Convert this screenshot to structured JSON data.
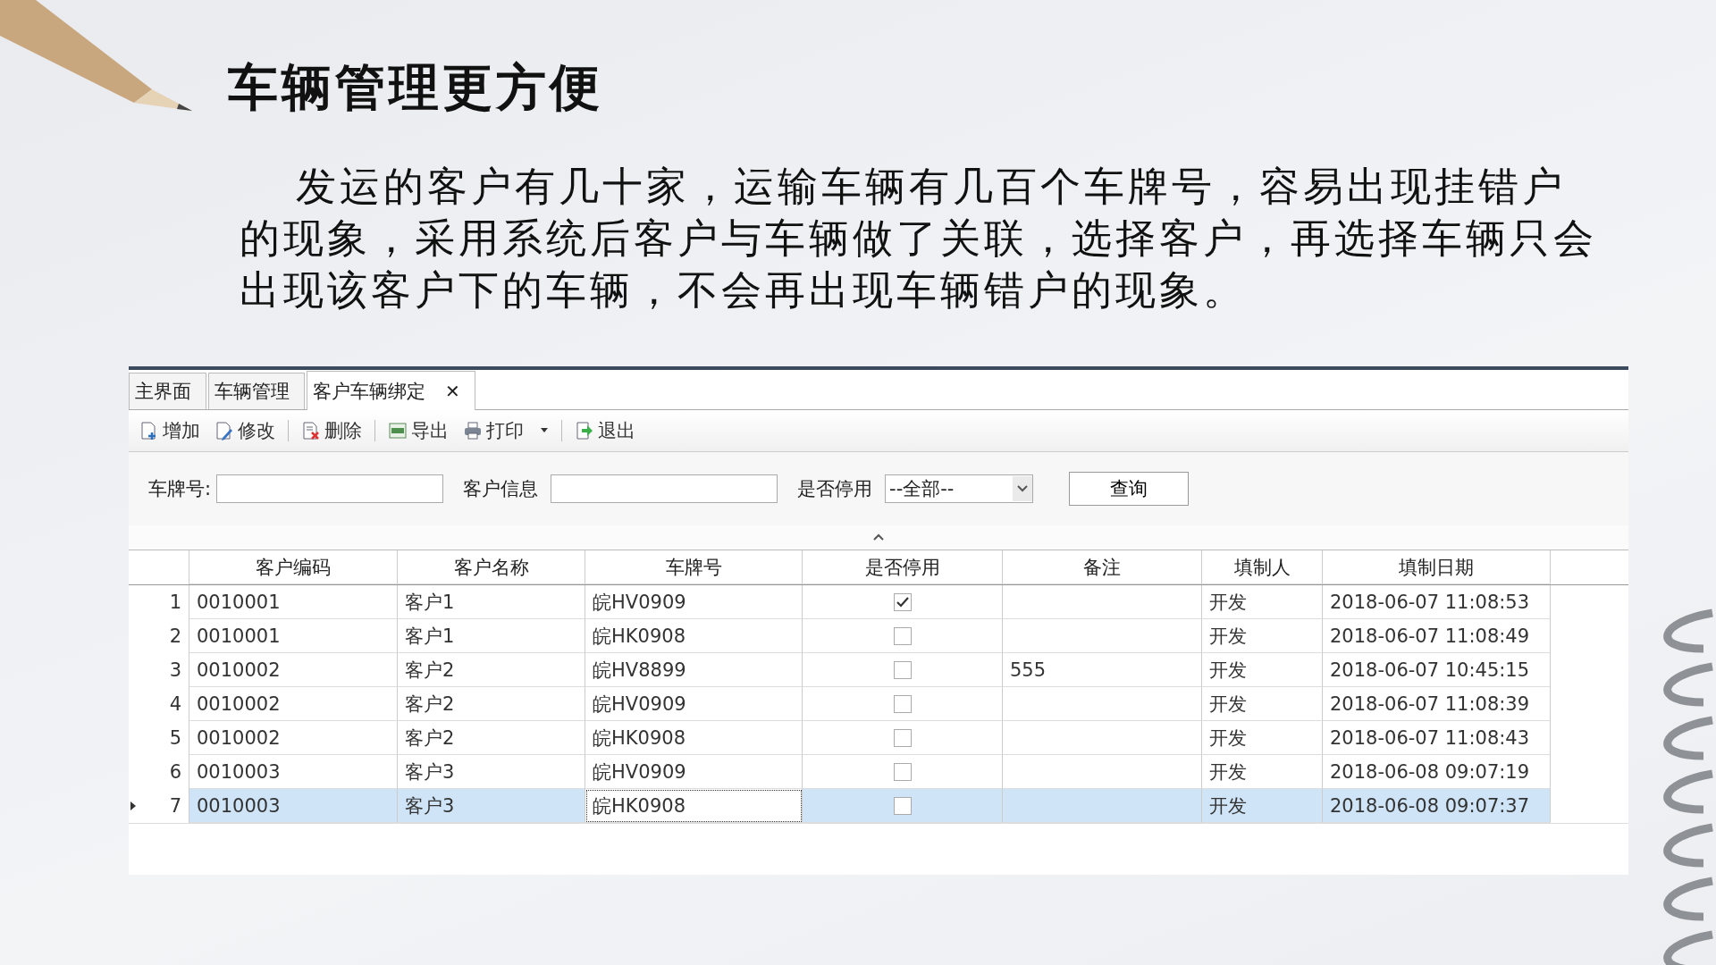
{
  "slide": {
    "title": "车辆管理更方便",
    "paragraph": "发运的客户有几十家，运输车辆有几百个车牌号，容易出现挂错户的现象，采用系统后客户与车辆做了关联，选择客户，再选择车辆只会出现该客户下的车辆，不会再出现车辆错户的现象。"
  },
  "tabs": [
    {
      "label": "主界面",
      "selected": false,
      "closable": false
    },
    {
      "label": "车辆管理",
      "selected": false,
      "closable": false
    },
    {
      "label": "客户车辆绑定",
      "selected": true,
      "closable": true,
      "close": "✕"
    }
  ],
  "toolbar": [
    {
      "kind": "add",
      "label": "增加",
      "dropdown": false
    },
    {
      "kind": "edit",
      "label": "修改",
      "dropdown": false
    },
    {
      "kind": "delete",
      "label": "删除",
      "dropdown": false
    },
    {
      "kind": "export",
      "label": "导出",
      "dropdown": false
    },
    {
      "kind": "print",
      "label": "打印",
      "dropdown": true
    },
    {
      "kind": "exit",
      "label": "退出",
      "dropdown": false
    }
  ],
  "filters": {
    "plate_label": "车牌号:",
    "customer_label": "客户信息",
    "stopped_label": "是否停用",
    "stopped_value": "--全部--",
    "query_button": "查询"
  },
  "table": {
    "columns": [
      "客户编码",
      "客户名称",
      "车牌号",
      "是否停用",
      "备注",
      "填制人",
      "填制日期"
    ],
    "rows": [
      {
        "no": "1",
        "code": "0010001",
        "name": "客户1",
        "plate": "皖HV0909",
        "stopped": true,
        "note": "",
        "maker": "开发",
        "date": "2018-06-07 11:08:53",
        "selected": false
      },
      {
        "no": "2",
        "code": "0010001",
        "name": "客户1",
        "plate": "皖HK0908",
        "stopped": false,
        "note": "",
        "maker": "开发",
        "date": "2018-06-07 11:08:49",
        "selected": false
      },
      {
        "no": "3",
        "code": "0010002",
        "name": "客户2",
        "plate": "皖HV8899",
        "stopped": false,
        "note": "555",
        "maker": "开发",
        "date": "2018-06-07 10:45:15",
        "selected": false
      },
      {
        "no": "4",
        "code": "0010002",
        "name": "客户2",
        "plate": "皖HV0909",
        "stopped": false,
        "note": "",
        "maker": "开发",
        "date": "2018-06-07 11:08:39",
        "selected": false
      },
      {
        "no": "5",
        "code": "0010002",
        "name": "客户2",
        "plate": "皖HK0908",
        "stopped": false,
        "note": "",
        "maker": "开发",
        "date": "2018-06-07 11:08:43",
        "selected": false
      },
      {
        "no": "6",
        "code": "0010003",
        "name": "客户3",
        "plate": "皖HV0909",
        "stopped": false,
        "note": "",
        "maker": "开发",
        "date": "2018-06-08 09:07:19",
        "selected": false
      },
      {
        "no": "7",
        "code": "0010003",
        "name": "客户3",
        "plate": "皖HK0908",
        "stopped": false,
        "note": "",
        "maker": "开发",
        "date": "2018-06-08 09:07:37",
        "selected": true
      }
    ]
  }
}
